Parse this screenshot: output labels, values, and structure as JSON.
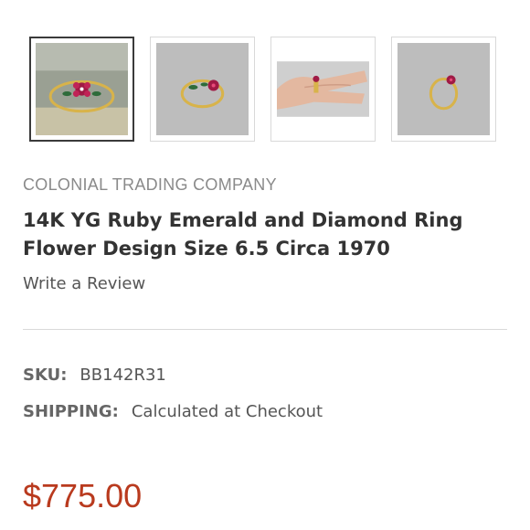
{
  "gallery": {
    "thumbnails": [
      {
        "label": "ring-closeup-on-stone",
        "active": true
      },
      {
        "label": "ring-on-grey",
        "active": false
      },
      {
        "label": "ring-on-hand",
        "active": false
      },
      {
        "label": "ring-side-view",
        "active": false
      }
    ]
  },
  "product": {
    "brand": "COLONIAL TRADING COMPANY",
    "title": "14K YG Ruby Emerald and Diamond Ring Flower Design Size 6.5 Circa 1970",
    "review_link": "Write a Review",
    "sku_label": "SKU:",
    "sku": "BB142R31",
    "shipping_label": "SHIPPING:",
    "shipping": "Calculated at Checkout",
    "price": "$775.00"
  },
  "colors": {
    "price": "#b93a1e",
    "brand": "#8a8a8a",
    "gold": "#d8b34a",
    "ruby": "#a01a45",
    "emerald": "#2e6b3a"
  }
}
